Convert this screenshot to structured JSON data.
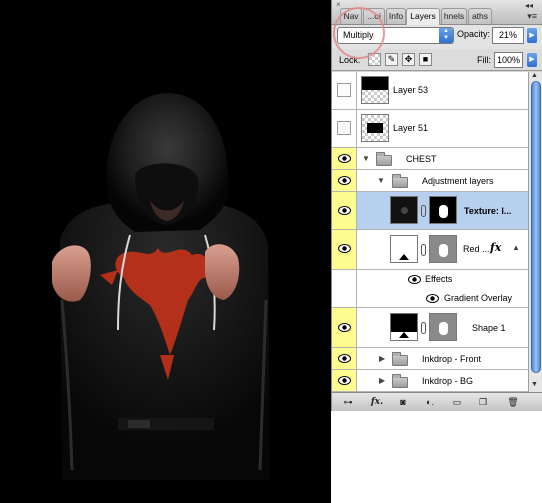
{
  "panel": {
    "tabs": [
      {
        "label": "Nav",
        "active": false
      },
      {
        "label": "...oi",
        "active": false
      },
      {
        "label": "Info",
        "active": false
      },
      {
        "label": "Layers",
        "active": true
      },
      {
        "label": "hnels",
        "active": false
      },
      {
        "label": "aths",
        "active": false
      }
    ],
    "close_glyph": "×",
    "collapse_glyph": "◂◂",
    "menu_glyph": "▾≡"
  },
  "options": {
    "blend_mode": "Multiply",
    "opacity_label": "Opacity:",
    "opacity_value": "21%",
    "lock_label": "Lock:",
    "fill_label": "Fill:",
    "fill_value": "100%"
  },
  "layers": [
    {
      "name": "Layer 53",
      "visible": false,
      "type": "layer"
    },
    {
      "name": "Layer 51",
      "visible": false,
      "type": "layer"
    },
    {
      "name": "CHEST",
      "visible": true,
      "type": "group",
      "expanded": true
    },
    {
      "name": "Adjustment layers",
      "visible": true,
      "type": "group",
      "expanded": true
    },
    {
      "name": "Texture: l...",
      "visible": true,
      "type": "layer",
      "selected": true
    },
    {
      "name": "Red ...",
      "visible": true,
      "type": "layer",
      "has_fx": true
    },
    {
      "name": "Effects",
      "type": "effects"
    },
    {
      "name": "Gradient Overlay",
      "type": "effect"
    },
    {
      "name": "Shape 1",
      "visible": true,
      "type": "layer"
    },
    {
      "name": "Inkdrop - Front",
      "visible": true,
      "type": "group",
      "expanded": false
    },
    {
      "name": "Inkdrop - BG",
      "visible": true,
      "type": "group",
      "expanded": false
    }
  ],
  "footer_buttons": [
    "link-icon",
    "fx-icon",
    "mask-icon",
    "adjustment-icon",
    "group-icon",
    "new-layer-icon",
    "trash-icon"
  ],
  "colors": {
    "visibility_on": "#fdfd8f",
    "selected_row": "#b8d0ef",
    "accent_blue": "#2f6fd0"
  }
}
